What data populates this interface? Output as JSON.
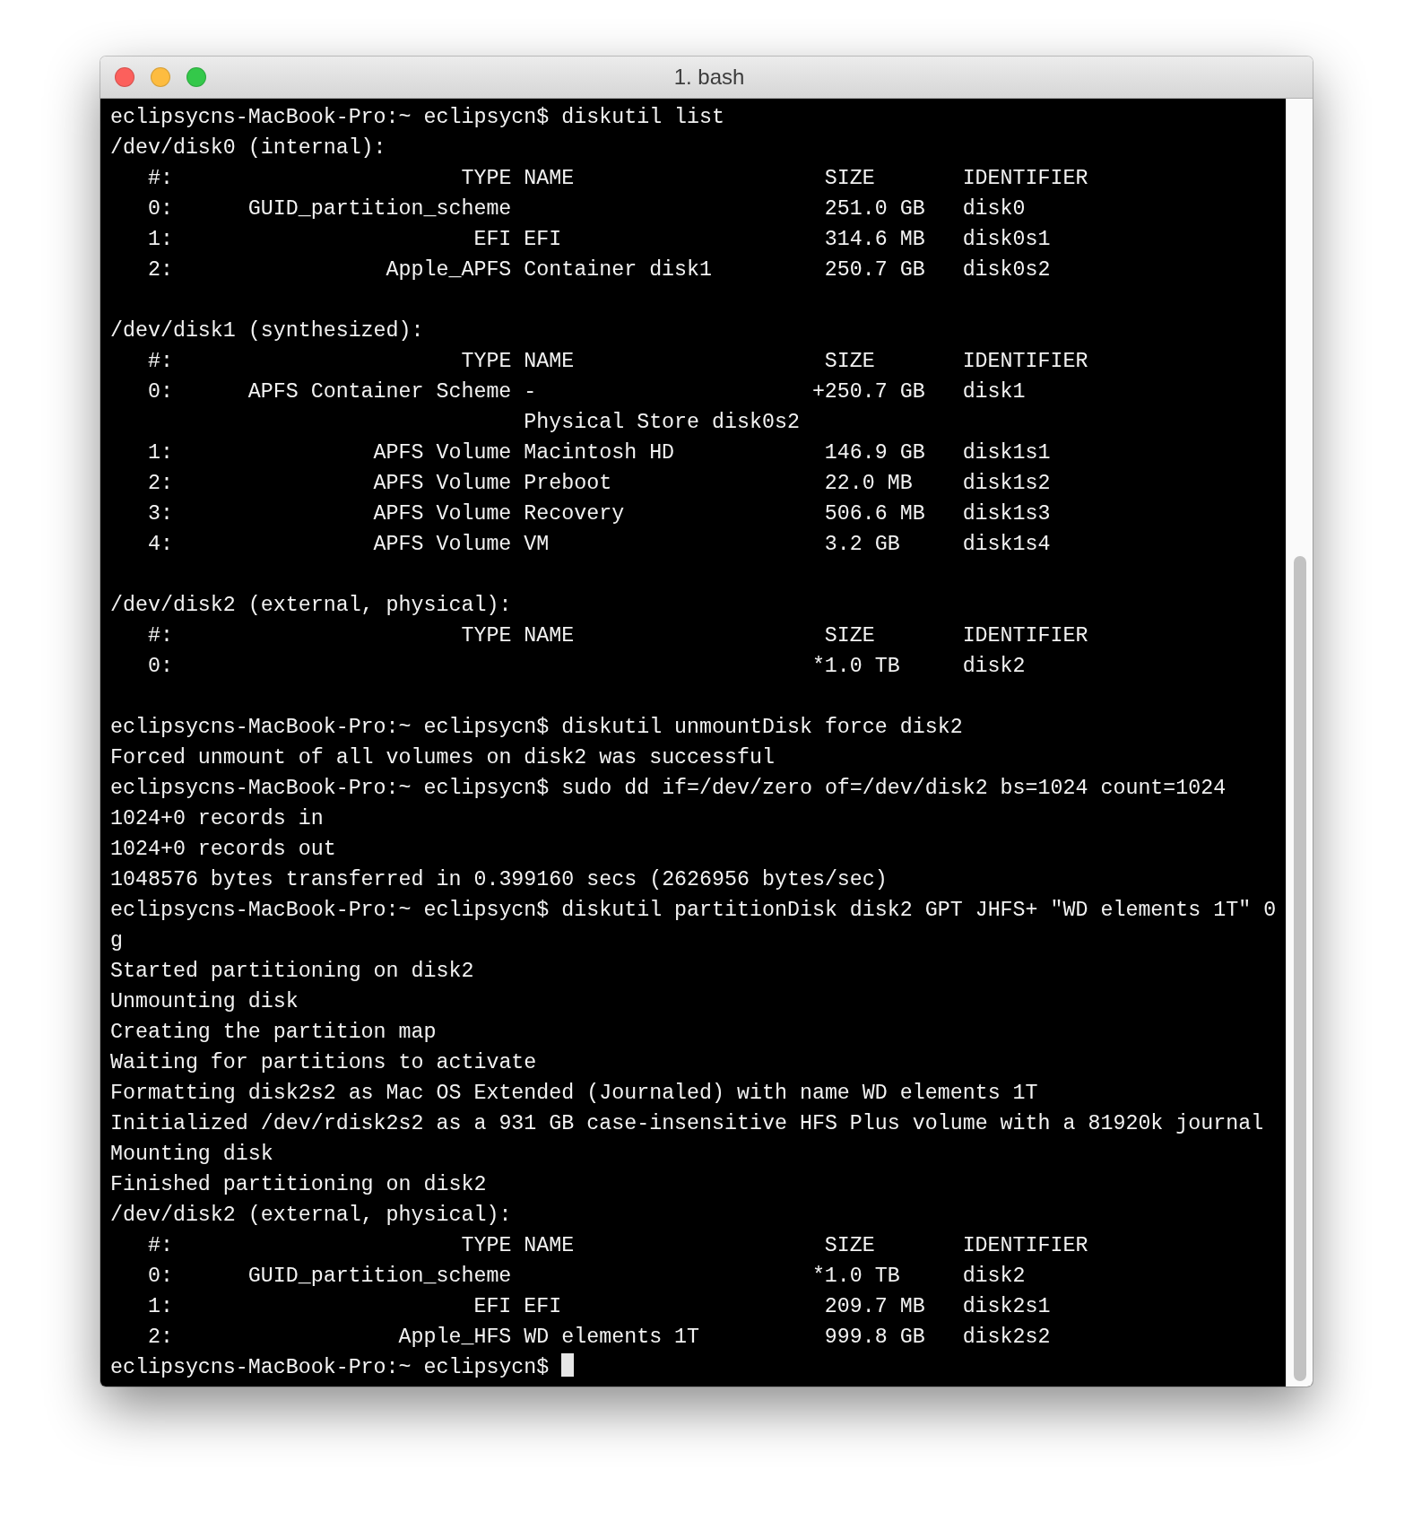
{
  "window": {
    "title": "1. bash"
  },
  "lines": [
    {
      "kind": "prompt",
      "prompt": "eclipsycns-MacBook-Pro:~ eclipsycn$",
      "command": "diskutil list"
    },
    {
      "kind": "output",
      "text": "/dev/disk0 (internal):"
    },
    {
      "kind": "row",
      "num": "#:",
      "type": "TYPE",
      "name": "NAME",
      "size": "SIZE",
      "identifier": "IDENTIFIER"
    },
    {
      "kind": "row",
      "num": "0:",
      "type": "GUID_partition_scheme",
      "size": "251.0 GB",
      "identifier": "disk0"
    },
    {
      "kind": "row",
      "num": "1:",
      "type": "EFI",
      "name": "EFI",
      "size": "314.6 MB",
      "identifier": "disk0s1"
    },
    {
      "kind": "row",
      "num": "2:",
      "type": "Apple_APFS",
      "name": "Container disk1",
      "size": "250.7 GB",
      "identifier": "disk0s2"
    },
    {
      "kind": "blank"
    },
    {
      "kind": "output",
      "text": "/dev/disk1 (synthesized):"
    },
    {
      "kind": "row",
      "num": "#:",
      "type": "TYPE",
      "name": "NAME",
      "size": "SIZE",
      "identifier": "IDENTIFIER"
    },
    {
      "kind": "row",
      "num": "0:",
      "type": "APFS Container Scheme",
      "name": "-",
      "size_mark": "+",
      "size": "250.7 GB",
      "identifier": "disk1"
    },
    {
      "kind": "row",
      "name": "Physical Store disk0s2"
    },
    {
      "kind": "row",
      "num": "1:",
      "type": "APFS Volume",
      "name": "Macintosh HD",
      "size": "146.9 GB",
      "identifier": "disk1s1"
    },
    {
      "kind": "row",
      "num": "2:",
      "type": "APFS Volume",
      "name": "Preboot",
      "size": "22.0 MB",
      "identifier": "disk1s2"
    },
    {
      "kind": "row",
      "num": "3:",
      "type": "APFS Volume",
      "name": "Recovery",
      "size": "506.6 MB",
      "identifier": "disk1s3"
    },
    {
      "kind": "row",
      "num": "4:",
      "type": "APFS Volume",
      "name": "VM",
      "size": "3.2 GB",
      "identifier": "disk1s4"
    },
    {
      "kind": "blank"
    },
    {
      "kind": "output",
      "text": "/dev/disk2 (external, physical):"
    },
    {
      "kind": "row",
      "num": "#:",
      "type": "TYPE",
      "name": "NAME",
      "size": "SIZE",
      "identifier": "IDENTIFIER"
    },
    {
      "kind": "row",
      "num": "0:",
      "size_mark": "*",
      "size": "1.0 TB",
      "identifier": "disk2"
    },
    {
      "kind": "blank"
    },
    {
      "kind": "prompt",
      "prompt": "eclipsycns-MacBook-Pro:~ eclipsycn$",
      "command": "diskutil unmountDisk force disk2"
    },
    {
      "kind": "output",
      "text": "Forced unmount of all volumes on disk2 was successful"
    },
    {
      "kind": "prompt",
      "prompt": "eclipsycns-MacBook-Pro:~ eclipsycn$",
      "command": "sudo dd if=/dev/zero of=/dev/disk2 bs=1024 count=1024"
    },
    {
      "kind": "output",
      "text": "1024+0 records in"
    },
    {
      "kind": "output",
      "text": "1024+0 records out"
    },
    {
      "kind": "output",
      "text": "1048576 bytes transferred in 0.399160 secs (2626956 bytes/sec)"
    },
    {
      "kind": "prompt",
      "prompt": "eclipsycns-MacBook-Pro:~ eclipsycn$",
      "command": "diskutil partitionDisk disk2 GPT JHFS+ \"WD elements 1T\" 0g"
    },
    {
      "kind": "output",
      "text": "Started partitioning on disk2"
    },
    {
      "kind": "output",
      "text": "Unmounting disk"
    },
    {
      "kind": "output",
      "text": "Creating the partition map"
    },
    {
      "kind": "output",
      "text": "Waiting for partitions to activate"
    },
    {
      "kind": "output",
      "text": "Formatting disk2s2 as Mac OS Extended (Journaled) with name WD elements 1T"
    },
    {
      "kind": "output",
      "text": "Initialized /dev/rdisk2s2 as a 931 GB case-insensitive HFS Plus volume with a 81920k journal"
    },
    {
      "kind": "output",
      "text": "Mounting disk"
    },
    {
      "kind": "output",
      "text": "Finished partitioning on disk2"
    },
    {
      "kind": "output",
      "text": "/dev/disk2 (external, physical):"
    },
    {
      "kind": "row",
      "num": "#:",
      "type": "TYPE",
      "name": "NAME",
      "size": "SIZE",
      "identifier": "IDENTIFIER"
    },
    {
      "kind": "row",
      "num": "0:",
      "type": "GUID_partition_scheme",
      "size_mark": "*",
      "size": "1.0 TB",
      "identifier": "disk2"
    },
    {
      "kind": "row",
      "num": "1:",
      "type": "EFI",
      "name": "EFI",
      "size": "209.7 MB",
      "identifier": "disk2s1"
    },
    {
      "kind": "row",
      "num": "2:",
      "type": "Apple_HFS",
      "name": "WD elements 1T",
      "size": "999.8 GB",
      "identifier": "disk2s2"
    },
    {
      "kind": "prompt",
      "prompt": "eclipsycns-MacBook-Pro:~ eclipsycn$",
      "cursor": true
    }
  ]
}
